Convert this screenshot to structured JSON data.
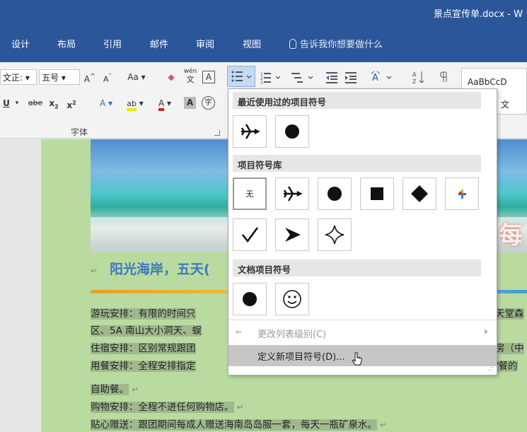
{
  "window": {
    "title": "景点宣传单.docx  -  W"
  },
  "ribbon_tabs": [
    "设计",
    "布局",
    "引用",
    "邮件",
    "审阅",
    "视图"
  ],
  "tell_me": "告诉我你想要做什么",
  "font": {
    "name": "文正:",
    "size": "五号",
    "grow_label": "A",
    "shrink_label": "A",
    "case_label": "Aa",
    "wen_label": "wén",
    "wen_char": "文",
    "border_char_label": "A",
    "underline_label": "U",
    "strike_label": "abe",
    "subscript_label": "x",
    "superscript_label": "x",
    "effects_label": "A",
    "highlight_label": "ab",
    "color_label": "A",
    "shading_label": "A",
    "enclose_label": "字",
    "group_label": "字体"
  },
  "styles": {
    "sample": "AaBbCcD",
    "name": "文"
  },
  "colors": {
    "title_bar": "#2b579a",
    "heading": "#3a79c4",
    "page_bg": "#b9dba0",
    "menu_hover": "#c6c6c6"
  },
  "document": {
    "heading": "阳光海岸，五天(",
    "lines": [
      "游玩安排：有限的时间只",
      "区、5A 南山大小洞天、蜈",
      "住宿安排：区别常规跟团",
      "用餐安排：全程安排指定",
      "自助餐。",
      "购物安排：全程不进任何购物店。",
      "贴心赠送：跟团期间每成人赠送海南岛岛服一套，每天一瓶矿泉水。"
    ],
    "right_lines": [
      "天堂森",
      "",
      "房（中",
      "/餐的"
    ],
    "banner_letter": "每"
  },
  "bullet_menu": {
    "recent_header": "最近使用过的项目符号",
    "library_header": "项目符号库",
    "document_header": "文档项目符号",
    "none_label": "无",
    "recent_icons": [
      "airplane-icon",
      "filled-circle-icon"
    ],
    "library_icons": [
      "none",
      "airplane-icon",
      "filled-circle-icon",
      "filled-square-icon",
      "filled-diamond-icon",
      "colored-cross-icon",
      "checkmark-icon",
      "arrowhead-icon",
      "four-point-star-icon"
    ],
    "document_icons": [
      "filled-circle-icon",
      "smiley-icon"
    ],
    "change_level": "更改列表级别(C)",
    "define_new": "定义新项目符号(D)..."
  }
}
